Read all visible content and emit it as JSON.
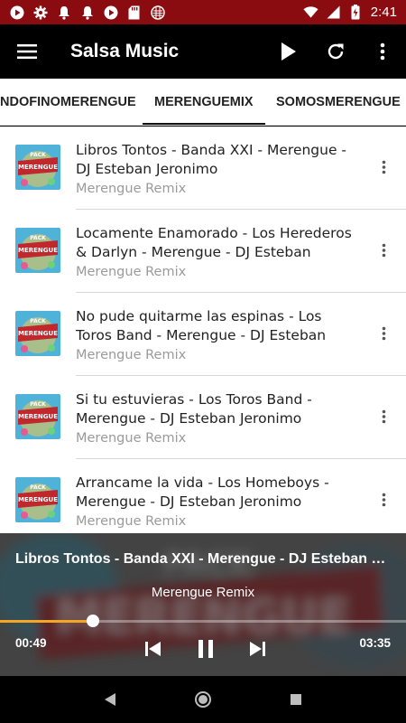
{
  "status_bar": {
    "time": "2:41",
    "left_icons": [
      "youtube-icon",
      "settings-icon",
      "notification-icon",
      "notification-icon",
      "youtube-icon",
      "sd-card-icon",
      "app-icon"
    ],
    "right_icons": [
      "wifi-icon",
      "signal-icon",
      "battery-charging-icon"
    ]
  },
  "toolbar": {
    "title": "Salsa Music",
    "actions": [
      "play-icon",
      "refresh-icon",
      "more-vert-icon"
    ]
  },
  "tabs": [
    {
      "label": "NDOFINOMERENGUE",
      "active": false
    },
    {
      "label": "MERENGUEMIX",
      "active": true
    },
    {
      "label": "SOMOSMERENGUE",
      "active": false
    }
  ],
  "tracks": [
    {
      "title": "Libros Tontos - Banda XXI - Merengue - DJ Esteban Jeronimo",
      "subtitle": "Merengue Remix"
    },
    {
      "title": "Locamente Enamorado - Los Herederos & Darlyn - Merengue - DJ Esteban",
      "subtitle": "Merengue Remix"
    },
    {
      "title": "No pude quitarme las espinas - Los Toros Band - Merengue - DJ Esteban",
      "subtitle": "Merengue Remix"
    },
    {
      "title": "Si tu estuvieras - Los Toros Band - Merengue - DJ Esteban Jeronimo",
      "subtitle": "Merengue Remix"
    },
    {
      "title": "Arrancame la vida - Los Homeboys - Merengue - DJ Esteban Jeronimo",
      "subtitle": "Merengue Remix"
    }
  ],
  "player": {
    "title": "Libros Tontos - Banda XXI - Merengue - DJ Esteban Jeronimo",
    "subtitle": "Merengue Remix",
    "current_time": "00:49",
    "total_time": "03:35",
    "progress_fraction": 0.228,
    "accent_color": "#f5a623"
  },
  "colors": {
    "status_bar": "#8b0c10",
    "toolbar": "#000000",
    "progress": "#f5a623"
  }
}
